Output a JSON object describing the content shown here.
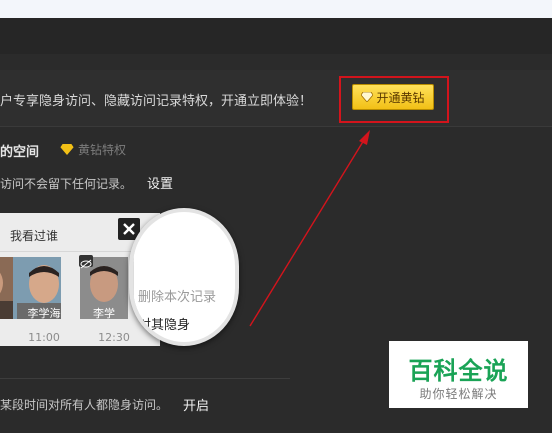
{
  "promo": {
    "text": "户专享隐身访问、隐藏访问记录特权，开通立即体验！",
    "vip_button_label": "开通黄钻"
  },
  "space": {
    "title": "的空间",
    "vip_privilege": "黄钻特权",
    "description": "访问不会留下任何记录。",
    "settings_link": "设置"
  },
  "visitor_card": {
    "title": "我看过谁",
    "visitors": [
      {
        "name": "",
        "time": ""
      },
      {
        "name": "李学海",
        "time": "11:00"
      },
      {
        "name": "李学",
        "time": "12:30"
      }
    ]
  },
  "context_menu": {
    "items": [
      "删除本次记录",
      "对其隐身"
    ],
    "partial_name": "学"
  },
  "timed_invisible": {
    "description": "某段时间对所有人都隐身访问。",
    "enable_link": "开启"
  },
  "watermark": {
    "main": "百科全说",
    "sub": "助你轻松解决"
  },
  "colors": {
    "annotation": "#d3141c",
    "vip_yellow": "#f2c016",
    "watermark_green": "#1aa356"
  }
}
